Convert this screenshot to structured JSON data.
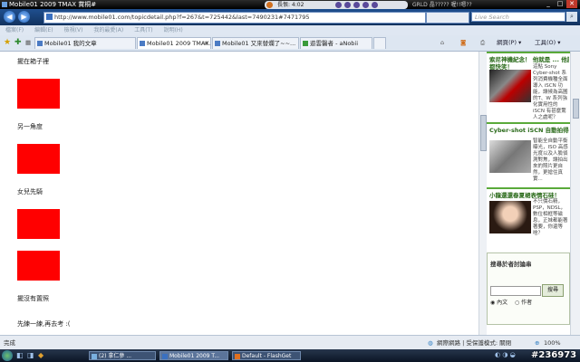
{
  "window": {
    "title": "Mobile01 2009 TMAX 賞桐#",
    "player_title": "長恨: 4:02",
    "player_misc": "GRLD 晶?????  喔!!嗯??",
    "controls": {
      "minimize": "_",
      "maximize": "□",
      "close": "✕"
    }
  },
  "nav": {
    "url": "http://www.mobile01.com/topicdetail.php?f=267&t=725442&last=7490231#7471795",
    "search_placeholder": "Live Search",
    "back_icon": "back-arrow-icon",
    "forward_icon": "forward-arrow-icon"
  },
  "menu": [
    "檔案(F)",
    "編輯(E)",
    "檢視(V)",
    "我的最愛(A)",
    "工具(T)",
    "說明(H)"
  ],
  "tabs": [
    {
      "label": "Mobile01 我的文章",
      "active": false
    },
    {
      "label": "Mobile01 2009 TMAX...",
      "active": true
    },
    {
      "label": "Mobile01 又來替爛了~~...",
      "active": false
    },
    {
      "label": "遊雲醫者 - aNobii",
      "active": false
    }
  ],
  "toolbar": {
    "page_label": "網頁(P) ▾",
    "tools_label": "工具(O) ▾"
  },
  "content": {
    "texts": [
      "擺在箱子裡",
      "另一角度",
      "女兒先騎",
      "擺沒有置照",
      "先練一練,再去考 :("
    ]
  },
  "sidebar": {
    "item1": {
      "title": "索尼神機紀念！ 他就是 ... 他說算每",
      "desc": "這點 Sony Cyber-shot 系列消費機種全面導入 iSCN 功能，讓候為高圖的T、W 系列強化實用性的 iSCN 有甚麼驚人之處呢？",
      "title2": "都快笑！"
    },
    "item2": {
      "title": "Cyber-shot iSCN 自動拍得美，淫浴遊絲珠！",
      "desc": "智能全自動平衡曝光，ISO 高感光度以及人臉偵測對焦，讓拍出來的照片更自然，更搶住真實..."
    },
    "item3": {
      "title": "小龍還還春夏裙表情石硅！",
      "desc": "不只價石精，PSP，NDSL，數位相框等磁息，正妹都能著著要，你還等啥？"
    },
    "vote": {
      "title": "搜尋於者討論串",
      "button": "搜尋",
      "opt1": "內文",
      "opt2": "作者"
    }
  },
  "status": {
    "left": "完成",
    "zone": "網際網路 | 受保護模式: 關閉",
    "zoom": "100%"
  },
  "taskbar": {
    "items": [
      "(2) 拿仁參 ...",
      "Mobile01 2009 T...",
      "Default - FlashGet"
    ],
    "watermark": "#236973"
  },
  "colors": {
    "accent_red": "#ff0000",
    "title_bg": "#000000",
    "nav_bg": "#1f4f8f"
  }
}
